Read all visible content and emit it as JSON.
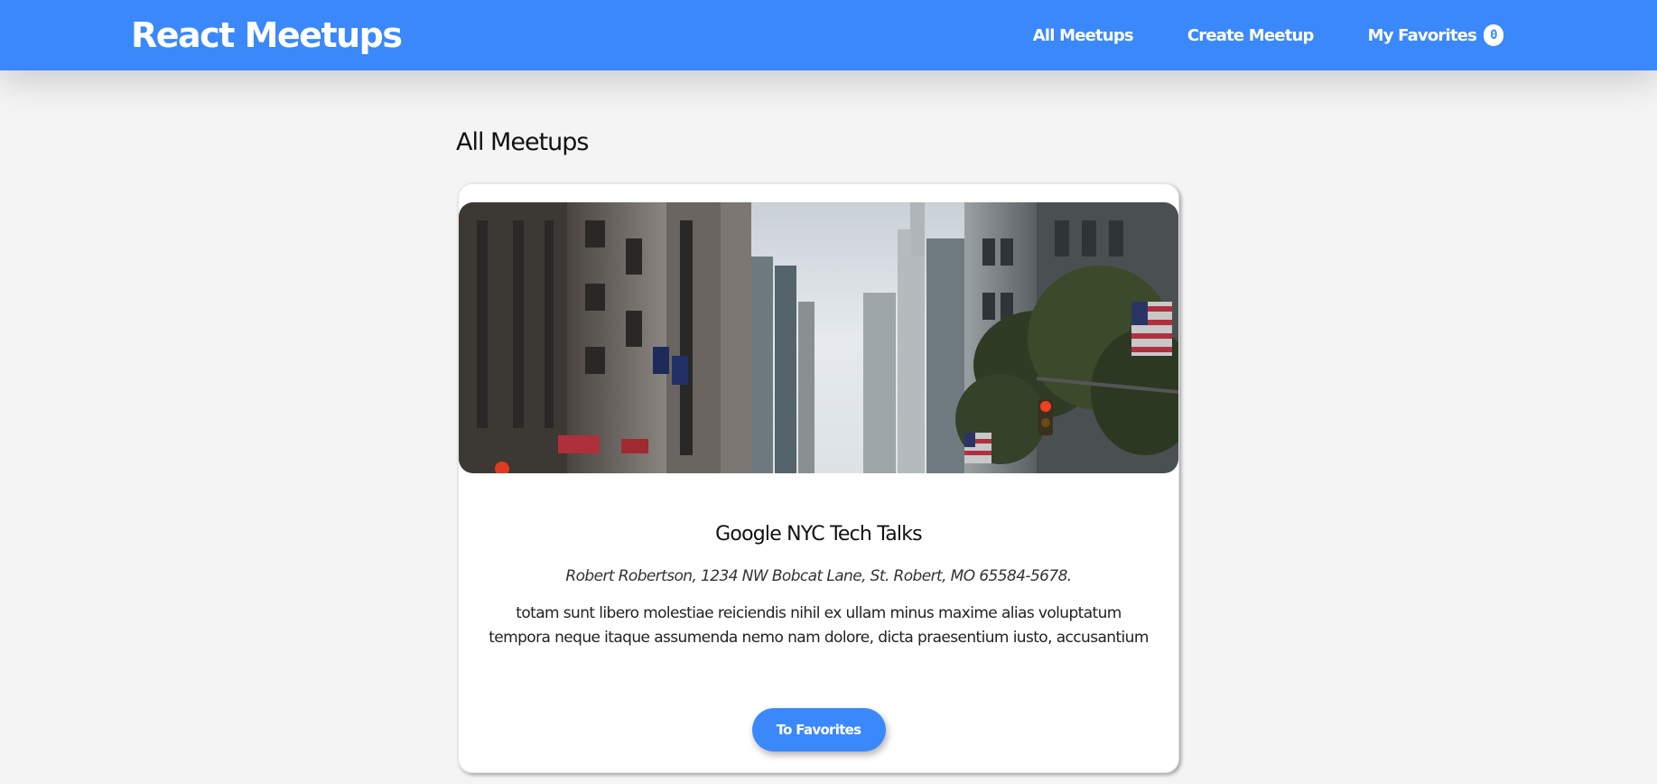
{
  "header": {
    "logo": "React Meetups",
    "nav": {
      "all_meetups": "All Meetups",
      "create_meetup": "Create Meetup",
      "my_favorites": "My Favorites",
      "favorites_count": "0"
    },
    "accent_color": "#3b88fb"
  },
  "main": {
    "page_title": "All Meetups",
    "meetups": [
      {
        "title": "Google NYC Tech Talks",
        "address": "Robert Robertson, 1234 NW Bobcat Lane, St. Robert, MO 65584-5678.",
        "description": "totam sunt libero molestiae reiciendis nihil ex ullam minus maxime alias voluptatum tempora neque itaque assumenda nemo nam dolore, dicta praesentium iusto, accusantium",
        "button_label": "To Favorites"
      }
    ]
  }
}
